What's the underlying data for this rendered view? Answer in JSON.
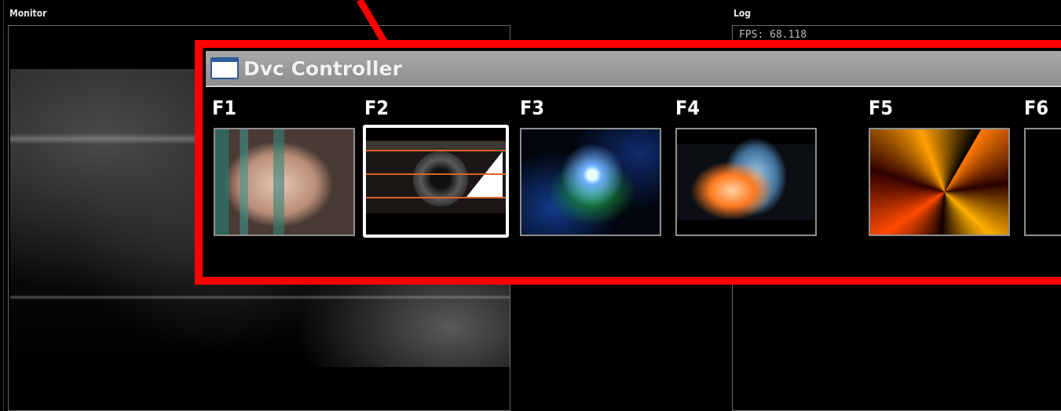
{
  "monitor_panel": {
    "label": "Monitor"
  },
  "log_panel": {
    "label": "Log",
    "fps_text": "FPS: 68.118"
  },
  "window": {
    "title": "Dvc Controller",
    "slots": [
      {
        "key": "F1",
        "thumbnail": "face-closeup",
        "selected": false
      },
      {
        "key": "F2",
        "thumbnail": "eye-closeup",
        "selected": true
      },
      {
        "key": "F3",
        "thumbnail": "blue-green-burst",
        "selected": false
      },
      {
        "key": "F4",
        "thumbnail": "orange-blue-craft",
        "selected": false
      },
      {
        "key": "F5",
        "thumbnail": "orange-red-shards",
        "selected": false
      },
      {
        "key": "F6",
        "thumbnail": "blank",
        "selected": false
      }
    ]
  },
  "colors": {
    "highlight": "#ff0000",
    "background": "#000000",
    "titlebar": "#9a9a9a",
    "thumb_border": "#8f8f8f",
    "selected_border": "#ffffff"
  }
}
